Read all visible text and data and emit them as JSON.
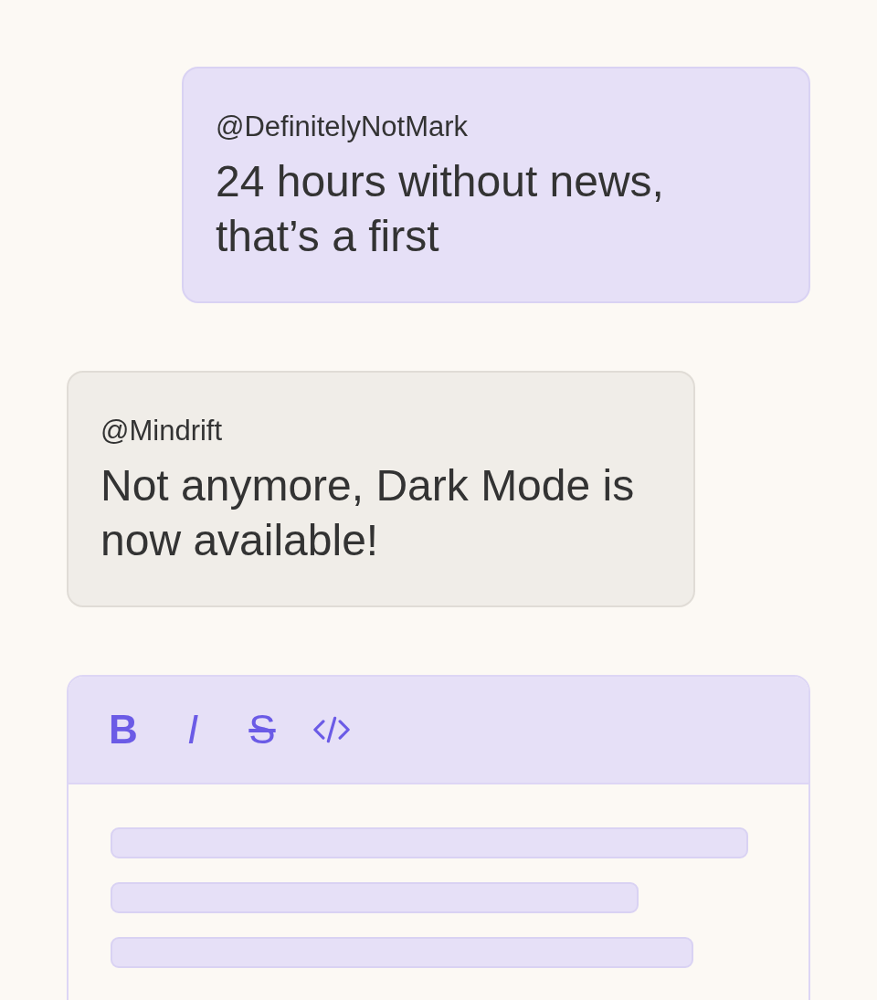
{
  "messages": [
    {
      "kind": "own",
      "handle": "@DefinitelyNotMark",
      "text": "24 hours without news, that’s a first"
    },
    {
      "kind": "other",
      "handle": "@Mindrift",
      "text": "Not anymore, Dark Mode is now available!"
    }
  ],
  "editor": {
    "toolbar": [
      {
        "kind": "bold",
        "label": "B"
      },
      {
        "kind": "italic",
        "label": "I"
      },
      {
        "kind": "strike",
        "label": "S"
      },
      {
        "kind": "code"
      }
    ]
  }
}
